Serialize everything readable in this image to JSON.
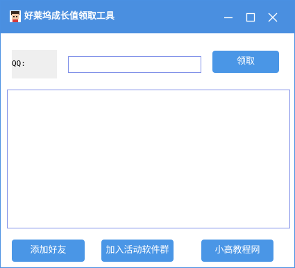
{
  "window": {
    "title": "好莱坞成长值领取工具",
    "icons": {
      "app": "app-avatar-icon",
      "minimize": "minimize-icon",
      "maximize": "maximize-icon",
      "close": "close-icon"
    }
  },
  "form": {
    "qq_label": "QQ:",
    "qq_value": "",
    "receive_button": "领取"
  },
  "log": {
    "content": ""
  },
  "footer": {
    "add_friend_button": "添加好友",
    "join_group_button": "加入活动软件群",
    "tutorial_button": "小高教程网"
  },
  "colors": {
    "titlebar": "#4a8fe0",
    "button": "#4a96e6",
    "input_border": "#7f8fe8",
    "label_bg": "#efefef"
  }
}
